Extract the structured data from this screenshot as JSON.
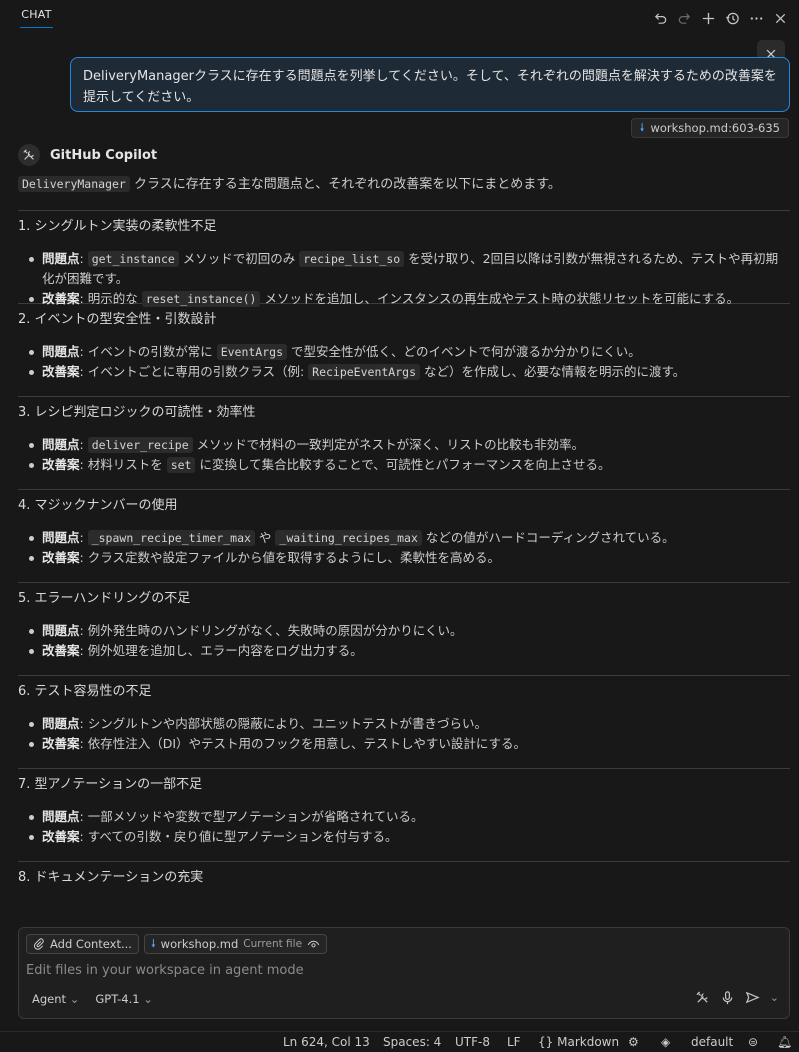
{
  "header": {
    "tab_label": "CHAT",
    "icons": [
      "undo-icon",
      "redo-icon",
      "plus-icon",
      "history-icon",
      "more-icon",
      "close-icon"
    ]
  },
  "user_message": {
    "line1": "DeliveryManagerクラスに存在する問題点を列挙してください。そして、それぞれの問題点を解決するための改善案を",
    "line2": "提示してください。"
  },
  "reference": {
    "file": "workshop.md",
    "range": ":603-635"
  },
  "assistant": {
    "name": "GitHub Copilot",
    "intro_code": "DeliveryManager",
    "intro_text": " クラスに存在する主な問題点と、それぞれの改善案を以下にまとめます。"
  },
  "labels": {
    "problem": "問題点",
    "fix": "改善案"
  },
  "sections": [
    {
      "title": "1. シングルトン実装の柔軟性不足",
      "problem": [
        ": ",
        {
          "code": "get_instance"
        },
        " メソッドで初回のみ ",
        {
          "code": "recipe_list_so"
        },
        " を受け取り、2回目以降は引数が無視されるため、テストや再初期化が困難です。"
      ],
      "fix": [
        ": 明示的な ",
        {
          "code": "reset_instance()"
        },
        " メソッドを追加し、インスタンスの再生成やテスト時の状態リセットを可能にする。"
      ]
    },
    {
      "title": "2. イベントの型安全性・引数設計",
      "problem": [
        ": イベントの引数が常に ",
        {
          "code": "EventArgs"
        },
        " で型安全性が低く、どのイベントで何が渡るか分かりにくい。"
      ],
      "fix": [
        ": イベントごとに専用の引数クラス（例: ",
        {
          "code": "RecipeEventArgs"
        },
        " など）を作成し、必要な情報を明示的に渡す。"
      ]
    },
    {
      "title": "3. レシピ判定ロジックの可読性・効率性",
      "problem": [
        ": ",
        {
          "code": "deliver_recipe"
        },
        " メソッドで材料の一致判定がネストが深く、リストの比較も非効率。"
      ],
      "fix": [
        ": 材料リストを ",
        {
          "code": "set"
        },
        " に変換して集合比較することで、可読性とパフォーマンスを向上させる。"
      ]
    },
    {
      "title": "4. マジックナンバーの使用",
      "problem": [
        ": ",
        {
          "code": "_spawn_recipe_timer_max"
        },
        " や ",
        {
          "code": "_waiting_recipes_max"
        },
        " などの値がハードコーディングされている。"
      ],
      "fix": [
        ": クラス定数や設定ファイルから値を取得するようにし、柔軟性を高める。"
      ]
    },
    {
      "title": "5. エラーハンドリングの不足",
      "problem": [
        ": 例外発生時のハンドリングがなく、失敗時の原因が分かりにくい。"
      ],
      "fix": [
        ": 例外処理を追加し、エラー内容をログ出力する。"
      ]
    },
    {
      "title": "6. テスト容易性の不足",
      "problem": [
        ": シングルトンや内部状態の隠蔽により、ユニットテストが書きづらい。"
      ],
      "fix": [
        ": 依存性注入（DI）やテスト用のフックを用意し、テストしやすい設計にする。"
      ]
    },
    {
      "title": "7. 型アノテーションの一部不足",
      "problem": [
        ": 一部メソッドや変数で型アノテーションが省略されている。"
      ],
      "fix": [
        ": すべての引数・戻り値に型アノテーションを付与する。"
      ]
    },
    {
      "title": "8. ドキュメンテーションの充実",
      "problem": null,
      "fix": null
    }
  ],
  "input": {
    "add_context": "Add Context...",
    "file_chip": "workshop.md",
    "file_chip_sub": "Current file",
    "placeholder": "Edit files in your workspace in agent mode",
    "mode": "Agent",
    "model": "GPT-4.1"
  },
  "statusbar": {
    "position": "Ln 624, Col 13",
    "spaces": "Spaces: 4",
    "encoding": "UTF-8",
    "eol": "LF",
    "language": "Markdown",
    "profile": "default"
  },
  "colors": {
    "accent": "#0078d4",
    "user_border": "#2488db",
    "file_icon": "#4fa6ff"
  }
}
